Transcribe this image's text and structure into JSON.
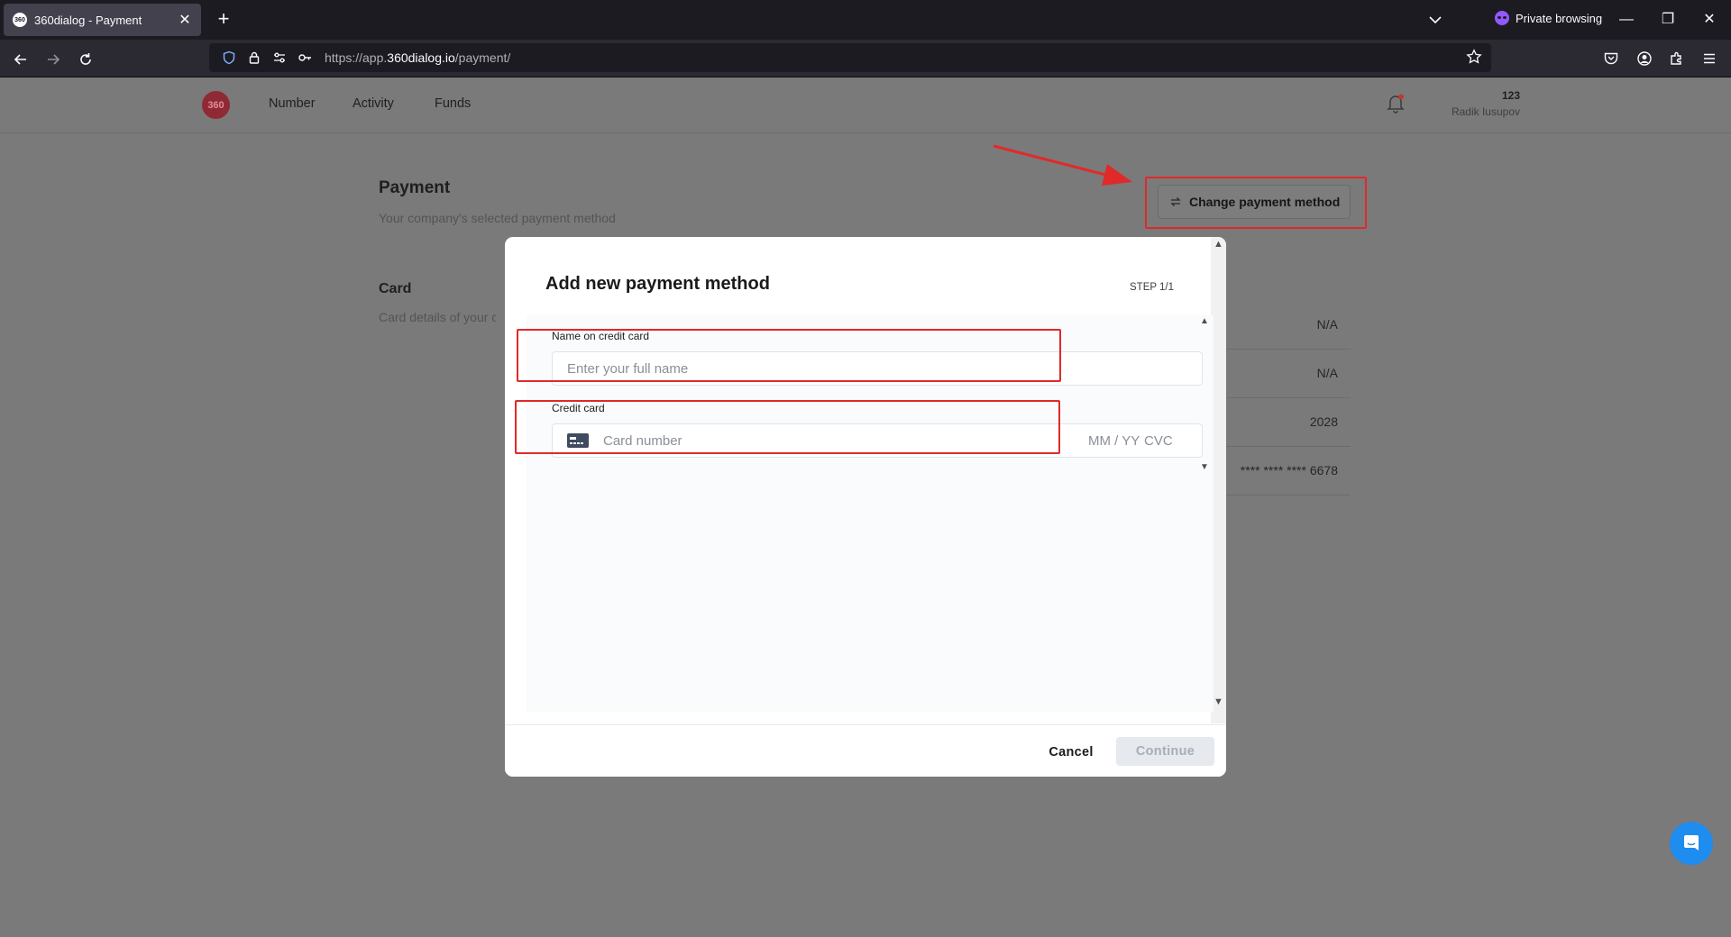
{
  "browser": {
    "tab_title": "360dialog - Payment",
    "favicon_text": "360",
    "new_tab": "+",
    "tab_close": "✕",
    "private_label": "Private browsing",
    "url_prefix": "https://app.",
    "url_domain": "360dialog.io",
    "url_path": "/payment/",
    "window_minimize": "—",
    "window_restore": "❐",
    "window_close": "✕"
  },
  "app": {
    "logo_text": "360",
    "nav": [
      "Number",
      "Activity",
      "Funds"
    ],
    "user_id": "123",
    "user_name": "Radik Iusupov"
  },
  "page": {
    "title": "Payment",
    "subtitle": "Your company's selected payment method",
    "card_title": "Card",
    "card_subtitle": "Card details of your company",
    "card_values": [
      "N/A",
      "N/A",
      "2028",
      "**** **** **** 6678"
    ],
    "change_button": "Change payment method"
  },
  "modal": {
    "title": "Add new payment method",
    "step": "STEP 1/1",
    "name_label": "Name on credit card",
    "name_placeholder": "Enter your full name",
    "card_label": "Credit card",
    "card_number_placeholder": "Card number",
    "card_expiry_placeholder": "MM / YY",
    "card_cvc_placeholder": "CVC",
    "cancel": "Cancel",
    "continue": "Continue"
  },
  "colors": {
    "highlight": "#e02a2a",
    "chat_button": "#1f8cf0",
    "logo": "#d64050",
    "private_accent": "#9059ff"
  }
}
